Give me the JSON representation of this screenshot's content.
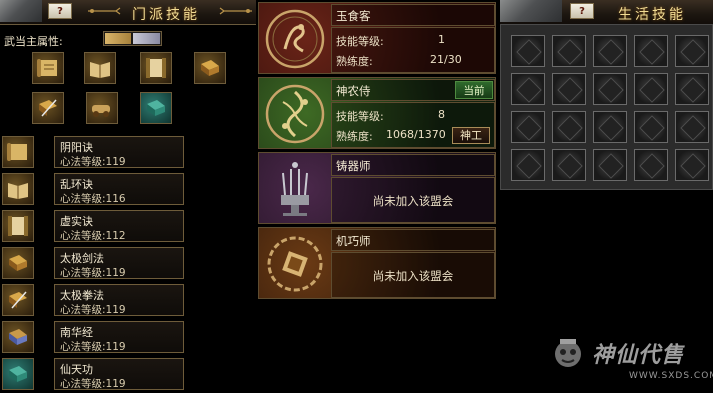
{
  "sect_panel": {
    "title": "门派技能",
    "help_label": "?",
    "attribute_label": "武当主属性:",
    "icons": [
      "scroll-book-icon",
      "open-book-icon",
      "scroll-pillars-icon",
      "golden-book-icon",
      "sword-book-icon",
      "cannon-scroll-icon",
      "jade-book-icon"
    ]
  },
  "sect_skills": [
    {
      "name": "阴阳诀",
      "level": "心法等级:119"
    },
    {
      "name": "乱环诀",
      "level": "心法等级:116"
    },
    {
      "name": "虚实诀",
      "level": "心法等级:112"
    },
    {
      "name": "太极剑法",
      "level": "心法等级:119"
    },
    {
      "name": "太极拳法",
      "level": "心法等级:119"
    },
    {
      "name": "南华经",
      "level": "心法等级:119"
    },
    {
      "name": "仙天功",
      "level": "心法等级:119"
    }
  ],
  "guilds": [
    {
      "name": "玉食客",
      "skill_label": "技能等级:",
      "skill_value": "1",
      "prof_label": "熟练度:",
      "prof_value": "21/30",
      "color": "#5a1c14"
    },
    {
      "name": "神农侍",
      "badge": "当前",
      "skill_label": "技能等级:",
      "skill_value": "8",
      "prof_label": "熟练度:",
      "prof_value": "1068/1370",
      "button": "神工",
      "color": "#2a4a1c"
    },
    {
      "name": "铸器师",
      "status": "尚未加入该盟会",
      "color": "#3a1e3a"
    },
    {
      "name": "机巧师",
      "status": "尚未加入该盟会",
      "color": "#5a3010"
    }
  ],
  "life_panel": {
    "title": "生活技能",
    "help_label": "?",
    "slot_rows": 4,
    "slot_cols": 5
  },
  "watermark": {
    "text": "神仙代售",
    "url": "WWW.SXDS.COM"
  },
  "colors": {
    "gold_text": "#f2dc93",
    "border": "#6e5c3a",
    "current_green": "#2f6a2c"
  }
}
